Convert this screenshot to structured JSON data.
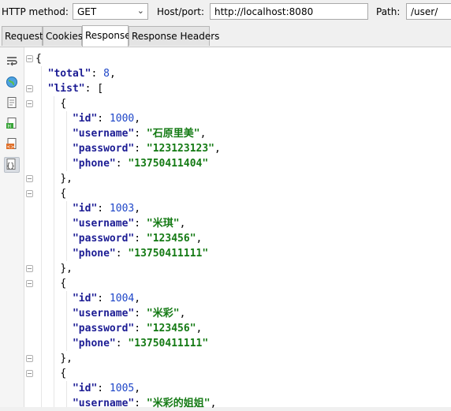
{
  "request": {
    "method_label": "HTTP method:",
    "method_value": "GET",
    "host_label": "Host/port:",
    "host_value": "http://localhost:8080",
    "path_label": "Path:",
    "path_value": "/user/"
  },
  "tabs": [
    {
      "label": "Request"
    },
    {
      "label": "Cookies"
    },
    {
      "label": "Response"
    },
    {
      "label": "Response Headers"
    }
  ],
  "active_tab": "Response",
  "sidebar_icons": [
    "wrap-icon",
    "globe-icon",
    "document-icon",
    "html-icon",
    "xml-icon",
    "json-icon"
  ],
  "response": {
    "total_key": "\"total\"",
    "total_value": "8",
    "list_key": "\"list\"",
    "items": [
      {
        "id": "1000",
        "username": "\"石原里美\"",
        "password": "\"123123123\"",
        "phone": "\"13750411404\""
      },
      {
        "id": "1003",
        "username": "\"米琪\"",
        "password": "\"123456\"",
        "phone": "\"13750411111\""
      },
      {
        "id": "1004",
        "username": "\"米彩\"",
        "password": "\"123456\"",
        "phone": "\"13750411111\""
      },
      {
        "id": "1005",
        "username": "\"米彩的姐姐\""
      }
    ],
    "keys": {
      "id": "\"id\"",
      "username": "\"username\"",
      "password": "\"password\"",
      "phone": "\"phone\""
    }
  }
}
